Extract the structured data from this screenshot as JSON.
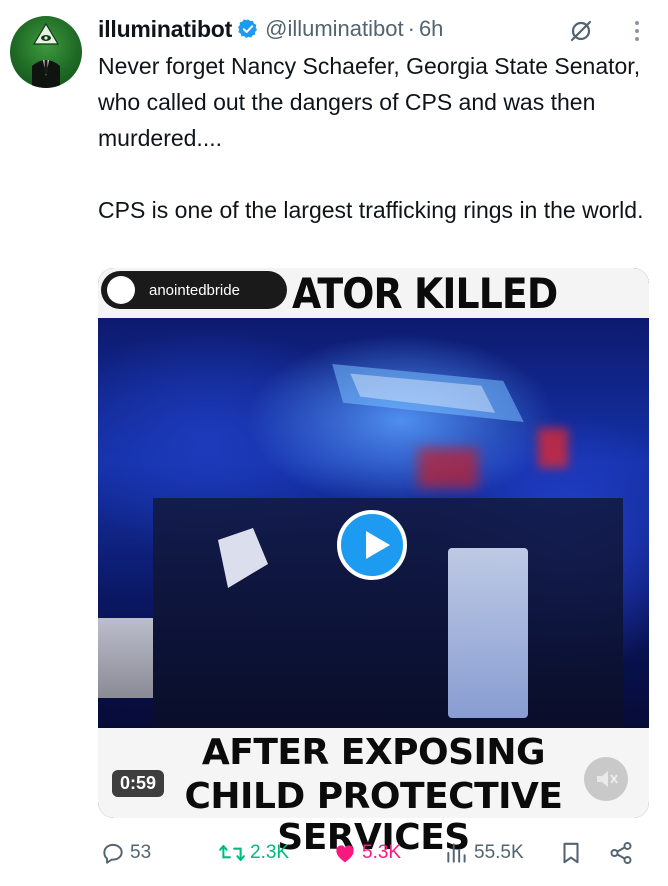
{
  "author": {
    "name": "illuminatibot",
    "handle": "@illuminatibot",
    "separator": "·",
    "time": "6h"
  },
  "tweet": {
    "paragraph1": "Never forget Nancy Schaefer, Georgia State Senator, who called out the dangers of CPS and was then murdered....",
    "paragraph2": "CPS is one of the largest trafficking rings in the world."
  },
  "video": {
    "uploader": "anointedbride",
    "headline_top": "ATOR KILLED",
    "headline_line1": "AFTER EXPOSING",
    "headline_line2": "CHILD PROTECTIVE SERVICES",
    "duration": "0:59"
  },
  "actions": {
    "replies": "53",
    "retweets": "2.3K",
    "likes": "5.3K",
    "views": "55.5K"
  },
  "colors": {
    "verified": "#1d9bf0",
    "retweet": "#00ba7c",
    "like": "#f91880",
    "muted_text": "#536471"
  }
}
